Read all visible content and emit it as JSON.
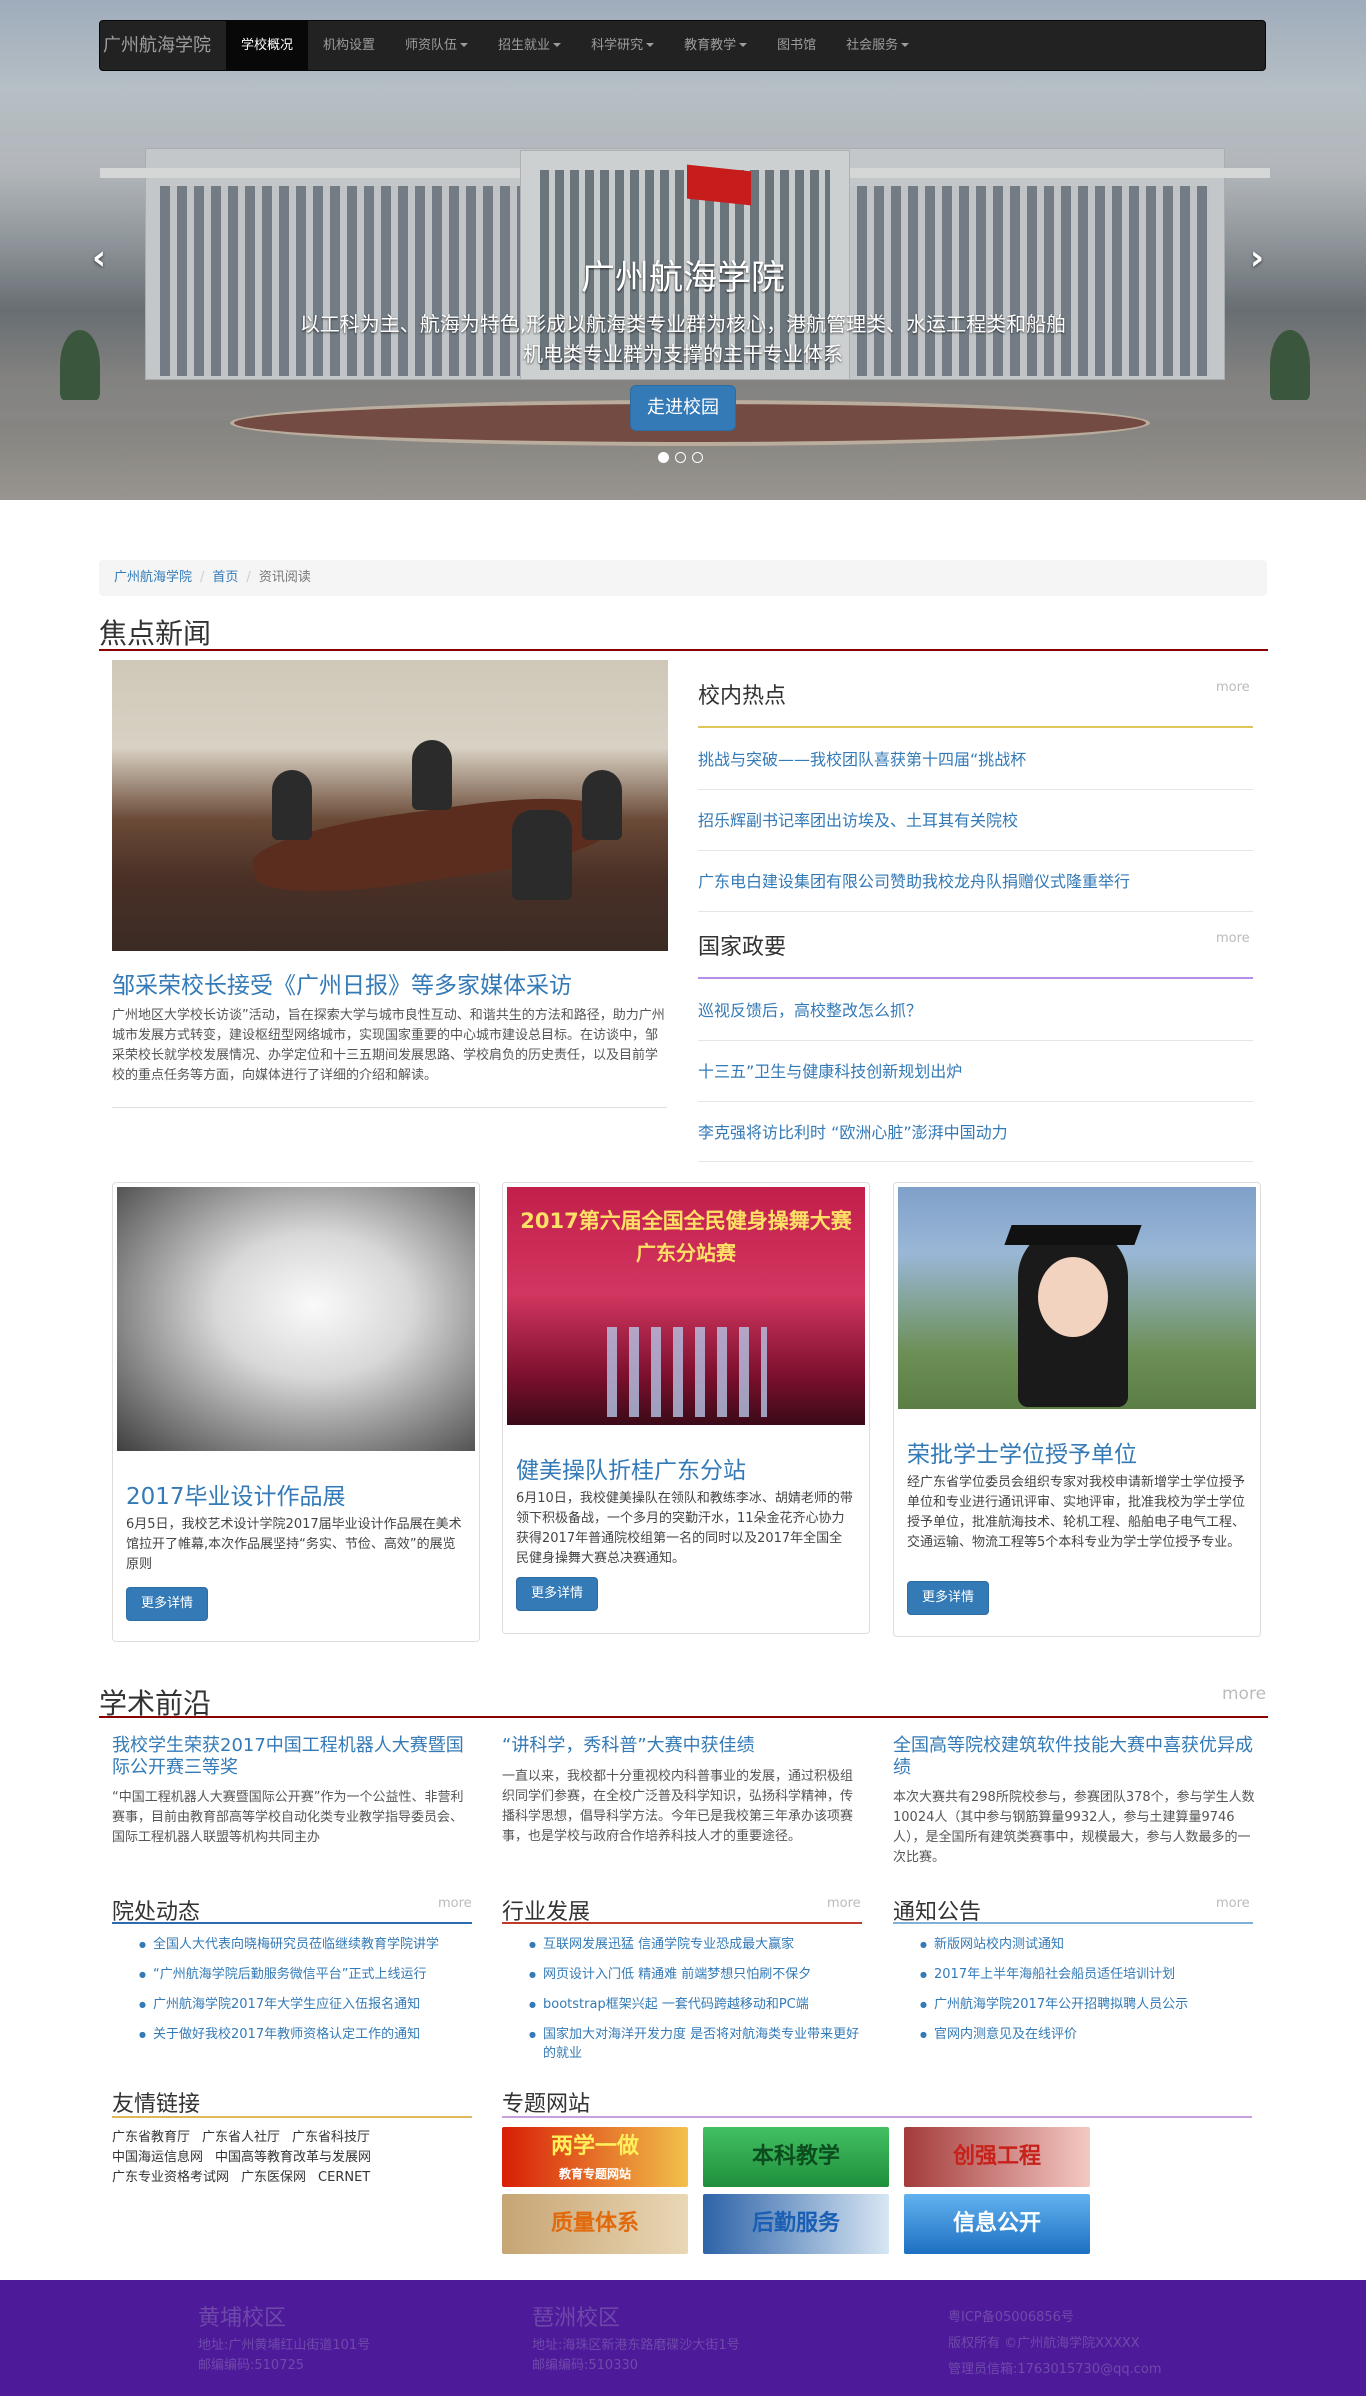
{
  "navbar": {
    "brand": "广州航海学院",
    "items": [
      {
        "label": "学校概况",
        "active": true,
        "dropdown": false
      },
      {
        "label": "机构设置",
        "active": false,
        "dropdown": false
      },
      {
        "label": "师资队伍",
        "active": false,
        "dropdown": true
      },
      {
        "label": "招生就业",
        "active": false,
        "dropdown": true
      },
      {
        "label": "科学研究",
        "active": false,
        "dropdown": true
      },
      {
        "label": "教育教学",
        "active": false,
        "dropdown": true
      },
      {
        "label": "图书馆",
        "active": false,
        "dropdown": false
      },
      {
        "label": "社会服务",
        "active": false,
        "dropdown": true
      }
    ]
  },
  "carousel": {
    "title": "广州航海学院",
    "text_line1": "以工科为主、航海为特色,形成以航海类专业群为核心，港航管理类、水运工程类和船舶",
    "text_line2": "机电类专业群为支撑的主干专业体系",
    "button": "走进校园",
    "prev_icon": "chevron-left-icon",
    "next_icon": "chevron-right-icon",
    "slides": 3,
    "active_slide": 1
  },
  "breadcrumb": [
    "广州航海学院",
    "首页",
    "资讯阅读"
  ],
  "focus": {
    "title": "焦点新闻",
    "lead_title": "邹采荣校长接受《广州日报》等多家媒体采访",
    "lead_text": "广州地区大学校长访谈”活动，旨在探索大学与城市良性互动、和谐共生的方法和路径，助力广州城市发展方式转变，建设枢纽型网络城市，实现国家重要的中心城市建设总目标。在访谈中，邹采荣校长就学校发展情况、办学定位和十三五期间发展思路、学校肩负的历史责任，以及目前学校的重点任务等方面，向媒体进行了详细的介绍和解读。"
  },
  "campus_hot": {
    "title": "校内热点",
    "more": "more",
    "items": [
      "挑战与突破——我校团队喜获第十四届“挑战杯",
      "招乐辉副书记率团出访埃及、土耳其有关院校",
      "广东电白建设集团有限公司赞助我校龙舟队捐赠仪式隆重举行"
    ]
  },
  "policy": {
    "title": "国家政要",
    "more": "more",
    "items": [
      "巡视反馈后，高校整改怎么抓？",
      "十三五”卫生与健康科技创新规划出炉",
      "李克强将访比利时 “欧洲心脏”澎湃中国动力"
    ]
  },
  "cards": [
    {
      "title": "2017毕业设计作品展",
      "text": "6月5日，我校艺术设计学院2017届毕业设计作品展在美术馆拉开了帷幕,本次作品展坚持“务实、节俭、高效”的展览原则",
      "button": "更多详情"
    },
    {
      "title": "健美操队折桂广东分站",
      "text": "6月10日，我校健美操队在领队和教练李冰、胡婧老师的带领下积极备战，一个多月的突勤汗水，11朵金花齐心协力获得2017年普通院校组第一名的同时以及2017年全国全民健身操舞大赛总决赛通知。",
      "button": "更多详情",
      "banner_line1": "2017第六届全国全民健身操舞大赛",
      "banner_line2": "广东分站赛"
    },
    {
      "title": "荣批学士学位授予单位",
      "text": "经广东省学位委员会组织专家对我校申请新增学士学位授予单位和专业进行通讯评审、实地评审，批准我校为学士学位授予单位，批准航海技术、轮机工程、船舶电子电气工程、交通运输、物流工程等5个本科专业为学士学位授予专业。",
      "button": "更多详情"
    }
  ],
  "academic": {
    "title": "学术前沿",
    "more": "more",
    "items": [
      {
        "title": "我校学生荣获2017中国工程机器人大赛暨国际公开赛三等奖",
        "text": "“中国工程机器人大赛暨国际公开赛”作为一个公益性、非营利赛事，目前由教育部高等学校自动化类专业教学指导委员会、国际工程机器人联盟等机构共同主办"
      },
      {
        "title": "“讲科学，秀科普”大赛中获佳绩",
        "text": "一直以来，我校都十分重视校内科普事业的发展，通过积极组织同学们参赛，在全校广泛普及科学知识，弘扬科学精神，传播科学思想，倡导科学方法。今年已是我校第三年承办该项赛事，也是学校与政府合作培养科技人才的重要途径。"
      },
      {
        "title": "全国高等院校建筑软件技能大赛中喜获优异成绩",
        "text": "本次大赛共有298所院校参与，参赛团队378个，参与学生人数10024人（其中参与钢筋算量9932人，参与土建算量9746人），是全国所有建筑类赛事中，规模最大，参与人数最多的一次比赛。"
      }
    ]
  },
  "dept_news": {
    "title": "院处动态",
    "more": "more",
    "items": [
      "全国人大代表向晓梅研究员莅临继续教育学院讲学",
      "“广州航海学院后勤服务微信平台”正式上线运行",
      "广州航海学院2017年大学生应征入伍报名通知",
      "关于做好我校2017年教师资格认定工作的通知"
    ]
  },
  "industry": {
    "title": "行业发展",
    "more": "more",
    "items": [
      "互联网发展迅猛 信通学院专业恐成最大赢家",
      "网页设计入门低 精通难 前端梦想只怕刷不保夕",
      "bootstrap框架兴起 一套代码跨越移动和PC端",
      "国家加大对海洋开发力度 是否将对航海类专业带来更好的就业"
    ]
  },
  "notice": {
    "title": "通知公告",
    "more": "more",
    "items": [
      "新版网站校内测试通知",
      "2017年上半年海船社会船员适任培训计划",
      "广州航海学院2017年公开招聘拟聘人员公示",
      "官网内测意见及在线评价"
    ]
  },
  "friend_links": {
    "title": "友情链接",
    "items": [
      "广东省教育厅",
      "广东省人社厅",
      "广东省科技厅",
      "中国海运信息网",
      "中国高等教育改革与发展网",
      "广东专业资格考试网",
      "广东医保网",
      "CERNET"
    ]
  },
  "special_sites": {
    "title": "专题网站",
    "banners": [
      {
        "label": "两学一做",
        "sub": "教育专题网站",
        "color": "#d81e06",
        "bg": "#f2c14a"
      },
      {
        "label": "本科教学",
        "sub": "",
        "color": "#0b4d1e",
        "bg": "#2aa84a"
      },
      {
        "label": "创强工程",
        "sub": "",
        "color": "#c8201a",
        "bg": "#f4c9c3"
      },
      {
        "label": "质量体系",
        "sub": "",
        "color": "#e26a0c",
        "bg": "#e9d7b5"
      },
      {
        "label": "后勤服务",
        "sub": "",
        "color": "#1a5fb4",
        "bg": "#d8e6f3"
      },
      {
        "label": "信息公开",
        "sub": "",
        "color": "#ffffff",
        "bg": "#2b8ad6"
      }
    ]
  },
  "footer": {
    "campus1": {
      "title": "黄埔校区",
      "addr": "地址:广州黄埔红山街道101号",
      "zip": "邮编编码:510725"
    },
    "campus2": {
      "title": "琶洲校区",
      "addr": "地址:海珠区新港东路磨碟沙大街1号",
      "zip": "邮编编码:510330"
    },
    "icp": "粤ICP备05006856号",
    "copyright": "版权所有 ©广州航海学院XXXXX",
    "admin": "管理员信箱:1763015730@qq.com"
  },
  "colors": {
    "accent": "#337ab7",
    "section_line": "#8b0000",
    "footer_bg": "#4d1a9a"
  }
}
